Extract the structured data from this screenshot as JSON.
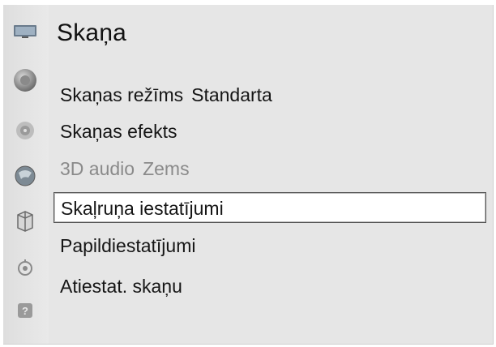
{
  "sidebar": {
    "icons": [
      {
        "name": "picture-icon"
      },
      {
        "name": "sound-icon"
      },
      {
        "name": "channel-icon"
      },
      {
        "name": "network-icon"
      },
      {
        "name": "system-icon"
      },
      {
        "name": "support-icon"
      },
      {
        "name": "help-icon"
      }
    ]
  },
  "menu": {
    "title": "Skaņa",
    "items": [
      {
        "label": "Skaņas režīms",
        "value": "Standarta"
      },
      {
        "label": "Skaņas efekts",
        "value": ""
      },
      {
        "label": "3D audio",
        "value": "Zems"
      },
      {
        "label": "Skaļruņa iestatījumi",
        "value": ""
      },
      {
        "label": "Papildiestatījumi",
        "value": ""
      },
      {
        "label": "Atiestat. skaņu",
        "value": ""
      }
    ],
    "selected_index": 3,
    "colors": {
      "panel": "#e6e6e6",
      "selected_bg": "#ffffff",
      "disabled_text": "#8a8a8a"
    }
  }
}
